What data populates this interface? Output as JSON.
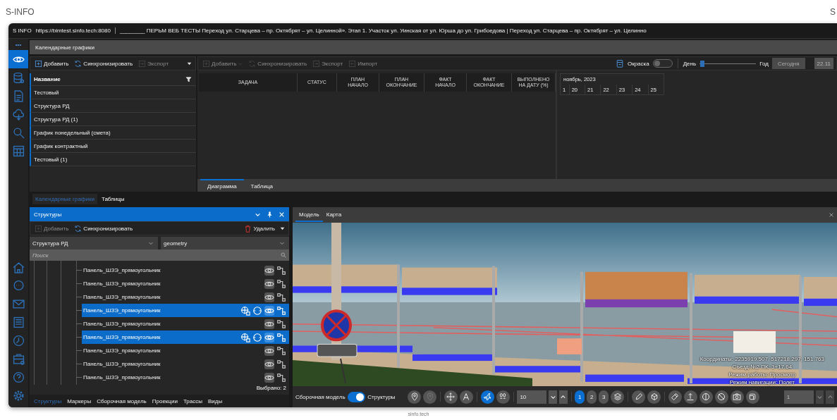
{
  "brand": "S-INFO",
  "brand_right": "S",
  "footer": "sinfo.tech",
  "window": {
    "app": "S INFO",
    "url": "https://bimtest.sinfo.tech:8080",
    "title": "________ ПЕРЬМ ВЕБ ТЕСТЫ Переход ул. Старцева – пр. Октябрят – ул. Целинной». Этап 1. Участок ул. Уинская от ул. Юрша до ул. Грибоедова | Переход ул. Старцева – пр. Октябрят – ул. Целинно"
  },
  "rail": {
    "menu": "•••",
    "top_items": [
      {
        "selected": true
      },
      {
        "selected": false
      },
      {
        "selected": false
      },
      {
        "selected": false
      },
      {
        "selected": false
      },
      {
        "selected": false
      }
    ],
    "bottom_items": [
      {
        "selected": false
      },
      {
        "selected": false
      },
      {
        "selected": false
      },
      {
        "selected": false
      },
      {
        "selected": false
      },
      {
        "selected": false
      },
      {
        "selected": false
      },
      {
        "selected": false
      }
    ]
  },
  "panel_title": "Календарные графики",
  "schedules": {
    "toolbar": [
      {
        "label": "Добавить",
        "disabled": false
      },
      {
        "label": "Синхронизировать",
        "disabled": false
      },
      {
        "label": "Экспорт",
        "disabled": true
      }
    ],
    "column": "Название",
    "rows": [
      "Тестовый",
      "Структура РД",
      "Структура РД (1)",
      "График понедельный (смета)",
      "График контрактный",
      "Тестовый (1)"
    ]
  },
  "gantt": {
    "toolbar": [
      {
        "label": "Добавить",
        "disabled": true
      },
      {
        "label": "Синхронизировать",
        "disabled": true
      },
      {
        "label": "Экспорт",
        "disabled": true
      },
      {
        "label": "Импорт",
        "disabled": true
      }
    ],
    "coloring": {
      "label": "Окраска",
      "on": false
    },
    "scale": {
      "from": "День",
      "to": "Год",
      "level": 0.05
    },
    "today": {
      "label": "Сегодня",
      "disabled": true
    },
    "date": "22.11",
    "columns": [
      "ЗАДАЧА",
      "СТАТУС",
      "ПЛАН\nНАЧАЛО",
      "ПЛАН\nОКОНЧАНИЕ",
      "ФАКТ\nНАЧАЛО",
      "ФАКТ\nОКОНЧАНИЕ",
      "ВЫПОЛНЕНО\nНА ДАТУ (%)"
    ],
    "timeline": {
      "month": "ноябрь, 2023",
      "days": [
        "1",
        "20",
        "21",
        "22",
        "23",
        "24",
        "25"
      ]
    },
    "tabs": [
      {
        "label": "Диаграмма",
        "selected": true
      },
      {
        "label": "Таблица",
        "selected": false
      }
    ]
  },
  "section_tabs": [
    {
      "label": "Календарные графики",
      "selected": true
    },
    {
      "label": "Таблицы",
      "selected": false
    }
  ],
  "structures": {
    "title": "Структуры",
    "toolbar": {
      "add": {
        "label": "Добавить",
        "disabled": true
      },
      "sync": "Синхронизировать",
      "delete": "Удалить"
    },
    "structure_select": "Структура РД",
    "layer_select": "geometry",
    "search": {
      "placeholder": "Поиск"
    },
    "items": [
      {
        "label": "Панель_ШЗЭ_прямоугольник",
        "selected": false
      },
      {
        "label": "Панель_ШЗЭ_прямоугольник",
        "selected": false
      },
      {
        "label": "Панель_ШЗЭ_прямоугольник",
        "selected": false
      },
      {
        "label": "Панель_ШЗЭ_прямоугольник",
        "selected": true
      },
      {
        "label": "Панель_ШЗЭ_прямоугольник",
        "selected": false
      },
      {
        "label": "Панель_ШЗЭ_прямоугольник",
        "selected": true
      },
      {
        "label": "Панель_ШЗЭ_прямоугольник",
        "selected": false
      },
      {
        "label": "Панель_ШЗЭ_прямоугольник",
        "selected": false
      },
      {
        "label": "Панель_ШЗЭ_прямоугольник",
        "selected": false
      }
    ],
    "selected_count": "Выбрано: 2",
    "tabs": [
      {
        "label": "Структуры",
        "selected": true
      },
      {
        "label": "Маркеры",
        "selected": false
      },
      {
        "label": "Сборочная модель",
        "selected": false
      },
      {
        "label": "Проекции",
        "selected": false
      },
      {
        "label": "Трассы",
        "selected": false
      },
      {
        "label": "Виды",
        "selected": false
      }
    ]
  },
  "viewer": {
    "tabs": [
      {
        "label": "Модель",
        "selected": true
      },
      {
        "label": "Карта",
        "selected": false
      }
    ],
    "overlay": [
      "Координаты:  2235919.507,  517218.297,  151.763",
      "Съезд №2 ПК:  3+17.64",
      "Режим работы: Просмотр",
      "Режим навигации: Полет"
    ],
    "toolbar": {
      "toggle": {
        "left": "Сборочная модель",
        "right": "Структуры",
        "on": true
      },
      "nav_modes": [
        {
          "selected": true
        },
        {
          "selected": false
        }
      ],
      "level": "10",
      "pages": [
        {
          "label": "1",
          "selected": true
        },
        {
          "label": "2",
          "selected": false
        },
        {
          "label": "3",
          "selected": false
        }
      ],
      "page_field": "1"
    }
  }
}
